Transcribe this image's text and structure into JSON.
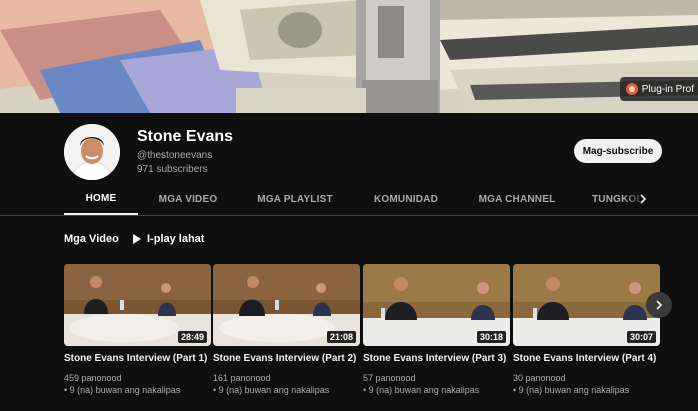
{
  "banner": {
    "plugin_label": "Plug-in Prof"
  },
  "channel": {
    "name": "Stone Evans",
    "handle": "@thestoneevans",
    "subscribers": "971 subscribers",
    "subscribe_label": "Mag-subscribe"
  },
  "tabs": [
    {
      "label": "HOME"
    },
    {
      "label": "MGA VIDEO"
    },
    {
      "label": "MGA PLAYLIST"
    },
    {
      "label": "KOMUNIDAD"
    },
    {
      "label": "MGA CHANNEL"
    },
    {
      "label": "TUNGKOL SA"
    }
  ],
  "section": {
    "title": "Mga Video",
    "play_all": "I-play lahat"
  },
  "videos": [
    {
      "title": "Stone Evans Interview (Part 1)",
      "duration": "28:49",
      "views": "459 panonood",
      "age": "• 9 (na) buwan ang nakalipas"
    },
    {
      "title": "Stone Evans Interview (Part 2)",
      "duration": "21:08",
      "views": "161 panonood",
      "age": "• 9 (na) buwan ang nakalipas"
    },
    {
      "title": "Stone Evans Interview (Part 3)",
      "duration": "30:18",
      "views": "57 panonood",
      "age": "• 9 (na) buwan ang nakalipas"
    },
    {
      "title": "Stone Evans Interview (Part 4)",
      "duration": "30:07",
      "views": "30 panonood",
      "age": "• 9 (na) buwan ang nakalipas"
    }
  ],
  "colors": {
    "background": "#0f0f0f",
    "text": "#f1f1f1",
    "secondary": "#aaaaaa",
    "subscribe_bg": "#f1f1f1"
  },
  "icons": {
    "play_all": "play-icon",
    "tabs_next": "chevron-right-icon",
    "carousel_next": "chevron-right-icon"
  }
}
